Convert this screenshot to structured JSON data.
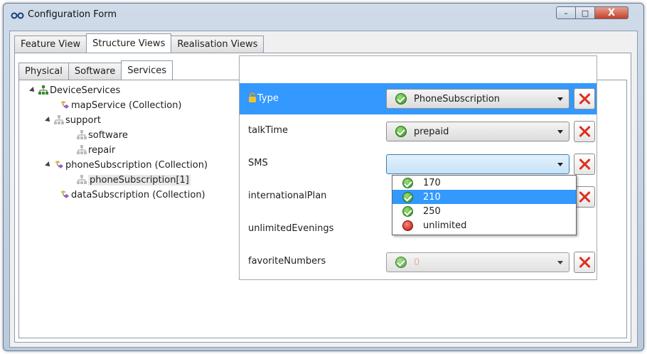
{
  "window": {
    "title": "Configuration Form",
    "controls": {
      "minimize": "–",
      "maximize": "□",
      "close": "X"
    }
  },
  "outer_tabs": [
    {
      "label": "Feature View",
      "active": false
    },
    {
      "label": "Structure Views",
      "active": true
    },
    {
      "label": "Realisation Views",
      "active": false
    }
  ],
  "inner_tabs": [
    {
      "label": "Physical",
      "active": false
    },
    {
      "label": "Software",
      "active": false
    },
    {
      "label": "Services",
      "active": true
    }
  ],
  "tree": [
    {
      "label": "DeviceServices",
      "icon": "hierarchy-icon",
      "expanded": true
    },
    {
      "label": "mapService (Collection)",
      "icon": "collection-icon"
    },
    {
      "label": "support",
      "icon": "hierarchy-icon",
      "expanded": true
    },
    {
      "label": "software",
      "icon": "hierarchy-icon"
    },
    {
      "label": "repair",
      "icon": "hierarchy-icon"
    },
    {
      "label": "phoneSubscription (Collection)",
      "icon": "collection-icon",
      "expanded": true
    },
    {
      "label": "phoneSubscription[1]",
      "icon": "hierarchy-icon",
      "selected": true
    },
    {
      "label": "dataSubscription (Collection)",
      "icon": "collection-icon"
    }
  ],
  "properties": [
    {
      "label": "Type",
      "value": "PhoneSubscription",
      "status": "green",
      "selected": true,
      "icon": "lock-icon"
    },
    {
      "label": "talkTime",
      "value": "prepaid",
      "status": "green"
    },
    {
      "label": "SMS",
      "value": "",
      "status": "none",
      "open": true
    },
    {
      "label": "internationalPlan",
      "value": "",
      "status": "none"
    },
    {
      "label": "unlimitedEvenings",
      "value": "",
      "status": "none"
    },
    {
      "label": "favoriteNumbers",
      "value": "0",
      "status": "green",
      "disabled": true
    }
  ],
  "sms_options": [
    {
      "label": "170",
      "status": "green",
      "highlighted": false
    },
    {
      "label": "210",
      "status": "green",
      "highlighted": true
    },
    {
      "label": "250",
      "status": "green",
      "highlighted": false
    },
    {
      "label": "unlimited",
      "status": "red",
      "highlighted": false
    }
  ],
  "colors": {
    "selection": "#3399ff",
    "delete": "#e0301e",
    "ok": "#2c8a1c",
    "error": "#b01010"
  }
}
